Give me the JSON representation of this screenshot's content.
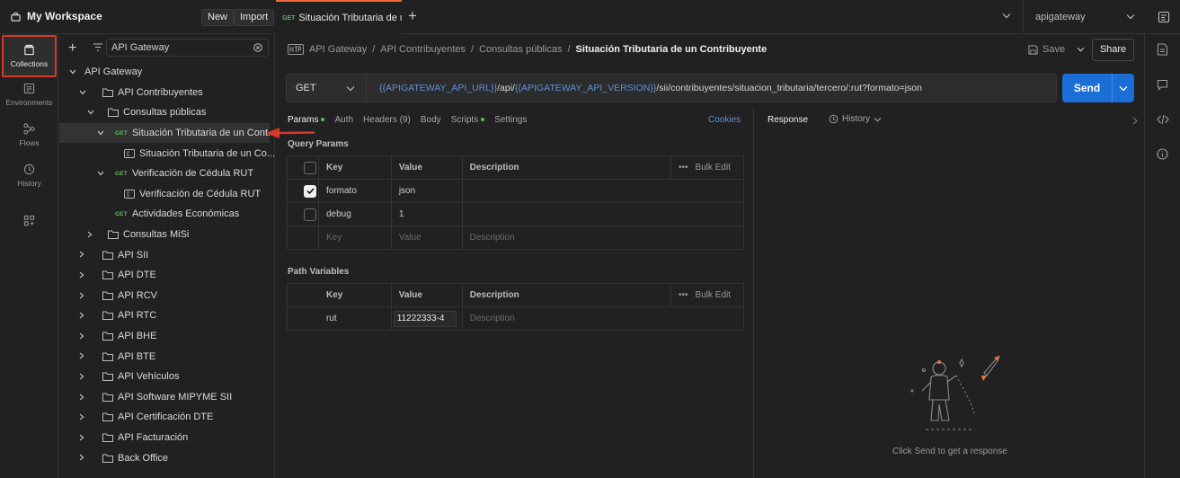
{
  "topbar": {
    "workspace": "My Workspace",
    "new_label": "New",
    "import_label": "Import",
    "active_tab": {
      "method": "GET",
      "title": "Situación Tributaria de u"
    },
    "environment": "apigateway"
  },
  "rail": {
    "collections": "Collections",
    "environments": "Environments",
    "flows": "Flows",
    "history": "History"
  },
  "sidebar": {
    "search_value": "API Gateway",
    "tree": [
      {
        "label": "API Gateway",
        "level": 0,
        "type": "collection",
        "expanded": true
      },
      {
        "label": "API Contribuyentes",
        "level": 1,
        "type": "folder",
        "expanded": true
      },
      {
        "label": "Consultas públicas",
        "level": 2,
        "type": "folder",
        "expanded": true
      },
      {
        "label": "Situación Tributaria de un Cont...",
        "level": 3,
        "type": "request",
        "method": "GET",
        "expanded": true,
        "selected": true
      },
      {
        "label": "Situación Tributaria de un Co...",
        "level": 4,
        "type": "example"
      },
      {
        "label": "Verificación de Cédula RUT",
        "level": 3,
        "type": "request",
        "method": "GET",
        "expanded": true
      },
      {
        "label": "Verificación de Cédula RUT",
        "level": 4,
        "type": "example"
      },
      {
        "label": "Actividades Económicas",
        "level": 3,
        "type": "request",
        "method": "GET"
      },
      {
        "label": "Consultas MiSi",
        "level": 2,
        "type": "folder"
      },
      {
        "label": "API SII",
        "level": 1,
        "type": "folder"
      },
      {
        "label": "API DTE",
        "level": 1,
        "type": "folder"
      },
      {
        "label": "API RCV",
        "level": 1,
        "type": "folder"
      },
      {
        "label": "API RTC",
        "level": 1,
        "type": "folder"
      },
      {
        "label": "API BHE",
        "level": 1,
        "type": "folder"
      },
      {
        "label": "API BTE",
        "level": 1,
        "type": "folder"
      },
      {
        "label": "API Vehículos",
        "level": 1,
        "type": "folder"
      },
      {
        "label": "API Software MIPYME SII",
        "level": 1,
        "type": "folder"
      },
      {
        "label": "API Certificación DTE",
        "level": 1,
        "type": "folder"
      },
      {
        "label": "API Facturación",
        "level": 1,
        "type": "folder"
      },
      {
        "label": "Back Office",
        "level": 1,
        "type": "folder"
      }
    ]
  },
  "request": {
    "breadcrumb": [
      "API Gateway",
      "API Contribuyentes",
      "Consultas públicas",
      "Situación Tributaria de un Contribuyente"
    ],
    "save_label": "Save",
    "share_label": "Share",
    "method": "GET",
    "url": {
      "var1": "{{APIGATEWAY_API_URL}}",
      "mid1": "/api/",
      "var2": "{{APIGATEWAY_API_VERSION}}",
      "rest": "/sii/contribuyentes/situacion_tributaria/tercero/:rut?formato=json"
    },
    "send_label": "Send",
    "tabs": {
      "params": "Params",
      "auth": "Auth",
      "headers": "Headers (9)",
      "body": "Body",
      "scripts": "Scripts",
      "settings": "Settings",
      "cookies": "Cookies"
    },
    "query_params": {
      "title": "Query Params",
      "headers": {
        "key": "Key",
        "value": "Value",
        "description": "Description",
        "bulk": "Bulk Edit"
      },
      "rows": [
        {
          "checked": true,
          "key": "formato",
          "value": "json"
        },
        {
          "checked": false,
          "key": "debug",
          "value": "1"
        }
      ],
      "placeholder": {
        "key": "Key",
        "value": "Value",
        "description": "Description"
      }
    },
    "path_variables": {
      "title": "Path Variables",
      "headers": {
        "key": "Key",
        "value": "Value",
        "description": "Description",
        "bulk": "Bulk Edit"
      },
      "rows": [
        {
          "key": "rut",
          "value": "11222333-4",
          "description_placeholder": "Description"
        }
      ]
    }
  },
  "response": {
    "label": "Response",
    "history": "History",
    "hint": "Click Send to get a response"
  },
  "colors": {
    "accent": "#1a6ed6",
    "get": "#5eb55e",
    "unsaved": "#f26b3a",
    "annotation": "#d9382b"
  }
}
